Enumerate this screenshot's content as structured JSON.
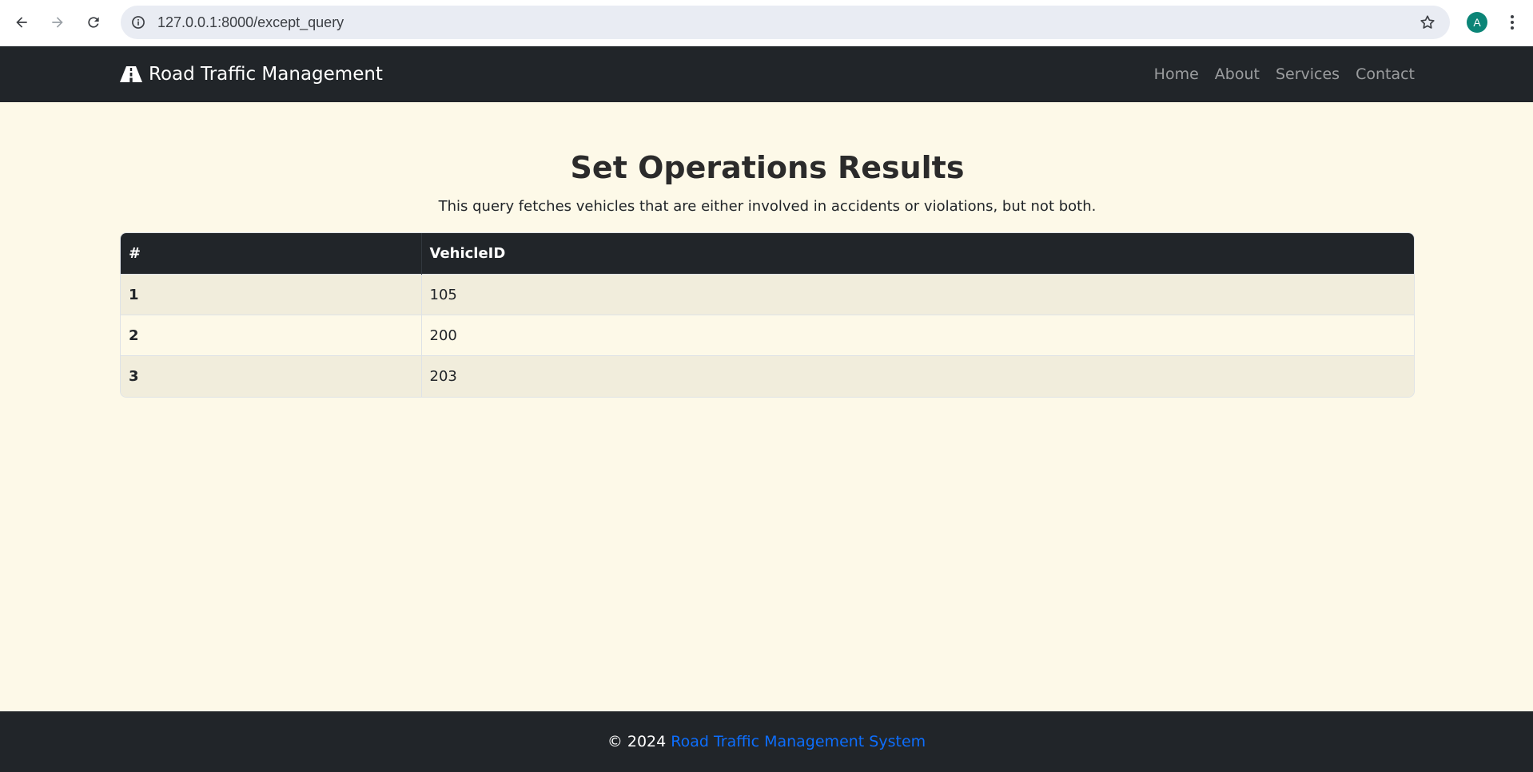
{
  "browser": {
    "url": "127.0.0.1:8000/except_query",
    "profile_initial": "A",
    "icons": {
      "back": "back-arrow-icon",
      "forward": "forward-arrow-icon",
      "reload": "reload-icon",
      "site_info": "site-info-icon",
      "bookmark": "bookmark-star-icon",
      "menu": "kebab-menu-icon"
    }
  },
  "navbar": {
    "brand_icon": "road-icon",
    "brand": "Road Traffic Management",
    "links": [
      "Home",
      "About",
      "Services",
      "Contact"
    ]
  },
  "main": {
    "title": "Set Operations Results",
    "subtitle": "This query fetches vehicles that are either involved in accidents or violations, but not both.",
    "table": {
      "headers": [
        "#",
        "VehicleID"
      ],
      "rows": [
        [
          "1",
          "105"
        ],
        [
          "2",
          "200"
        ],
        [
          "3",
          "203"
        ]
      ]
    }
  },
  "footer": {
    "copyright": "© 2024",
    "link_text": "Road Traffic Management System"
  },
  "colors": {
    "navbar_bg": "#212529",
    "page_bg": "#fdf9e8",
    "striped_row": "#f1eddc",
    "link": "#0d6efd",
    "avatar": "#0b8577"
  }
}
